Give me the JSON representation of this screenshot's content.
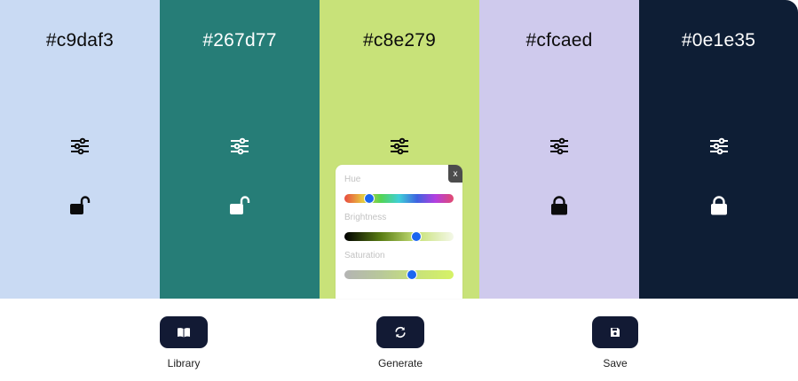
{
  "swatches": [
    {
      "hex": "#c9daf3",
      "color": "#c9daf3",
      "text": "dark",
      "locked": false
    },
    {
      "hex": "#267d77",
      "color": "#267d77",
      "text": "light",
      "locked": false
    },
    {
      "hex": "#c8e279",
      "color": "#c8e279",
      "text": "dark",
      "locked": false
    },
    {
      "hex": "#cfcaed",
      "color": "#cfcaed",
      "text": "dark",
      "locked": true
    },
    {
      "hex": "#0e1e35",
      "color": "#0e1e35",
      "text": "light",
      "locked": true
    }
  ],
  "icons": {
    "adjust": "sliders-icon",
    "unlocked": "unlocked-padlock-icon",
    "locked": "locked-padlock-icon",
    "library": "book-icon",
    "generate": "refresh-icon",
    "save": "floppy-disk-icon"
  },
  "color_popup": {
    "close_label": "x",
    "hue_label": "Hue",
    "brightness_label": "Brightness",
    "saturation_label": "Saturation",
    "hue_value": 0.23,
    "brightness_value": 0.66,
    "saturation_value": 0.62
  },
  "toolbar": {
    "library_label": "Library",
    "generate_label": "Generate",
    "save_label": "Save"
  },
  "colors": {
    "toolbar_button": "#121a34",
    "slider_thumb": "#1b66f0"
  }
}
